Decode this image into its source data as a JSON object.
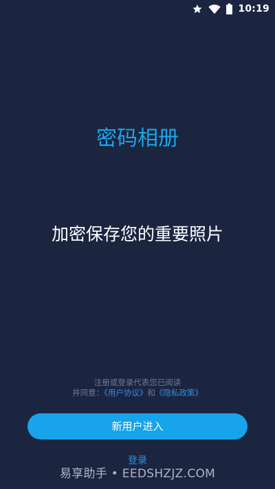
{
  "status_bar": {
    "time": "10:19",
    "icons": [
      "star-icon",
      "wifi-icon",
      "battery-icon"
    ]
  },
  "app": {
    "title": "密码相册",
    "tagline": "加密保存您的重要照片"
  },
  "agreement": {
    "line1": "注册或登录代表您已阅读",
    "prefix": "并同意：",
    "user_agreement": "《用户协议》",
    "conjunction": "和",
    "privacy_policy": "《隐私政策》"
  },
  "actions": {
    "new_user": "新用户进入",
    "login": "登录"
  },
  "watermark": {
    "text": "易享助手 • EEDSHZJZ.COM"
  },
  "colors": {
    "background": "#1b2540",
    "accent": "#18a4ea",
    "link": "#2e8fe0"
  }
}
